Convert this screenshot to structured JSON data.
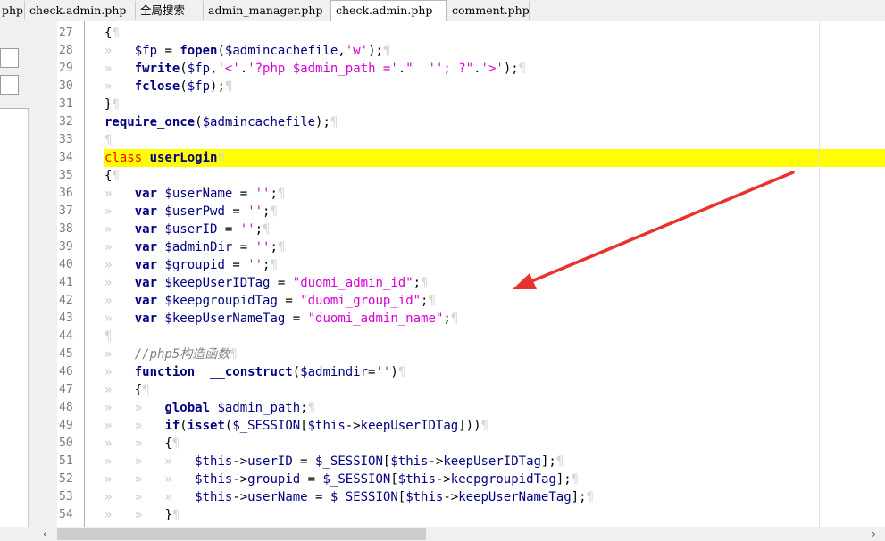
{
  "tabs": [
    {
      "label": "php"
    },
    {
      "label": "check.admin.php"
    },
    {
      "label": "全局搜索"
    },
    {
      "label": "admin_manager.php"
    },
    {
      "label": "check.admin.php"
    },
    {
      "label": "comment.php"
    }
  ],
  "active_tab": 4,
  "scroll": {
    "left": "‹",
    "right": "›"
  },
  "annotation": {
    "color": "#e8322b",
    "kind": "red-arrow"
  },
  "lines": [
    {
      "n": "27",
      "tokens": [
        [
          "",
          "{"
        ],
        [
          "pil",
          "¶"
        ]
      ]
    },
    {
      "n": "28",
      "tokens": [
        [
          "arr",
          "»   "
        ],
        [
          "var",
          "$fp"
        ],
        [
          "",
          ""
        ],
        [
          "",
          " = "
        ],
        [
          "fn",
          "fopen"
        ],
        [
          "",
          "("
        ],
        [
          "var",
          "$admincachefile"
        ],
        [
          "",
          ","
        ],
        [
          "str",
          "'w'"
        ],
        [
          "",
          ");"
        ],
        [
          "pil",
          "¶"
        ]
      ]
    },
    {
      "n": "29",
      "tokens": [
        [
          "arr",
          "»   "
        ],
        [
          "fn",
          "fwrite"
        ],
        [
          "",
          "("
        ],
        [
          "var",
          "$fp"
        ],
        [
          "",
          ","
        ],
        [
          "str",
          "'<'"
        ],
        [
          "",
          "."
        ],
        [
          "str",
          "'?php $admin_path ='"
        ],
        [
          "",
          "."
        ],
        [
          "str",
          "\"  ''; ?\""
        ],
        [
          "",
          "."
        ],
        [
          "str",
          "'>'"
        ],
        [
          "",
          ");"
        ],
        [
          "pil",
          "¶"
        ]
      ]
    },
    {
      "n": "30",
      "tokens": [
        [
          "arr",
          "»   "
        ],
        [
          "fn",
          "fclose"
        ],
        [
          "",
          "("
        ],
        [
          "var",
          "$fp"
        ],
        [
          "",
          ");"
        ],
        [
          "pil",
          "¶"
        ]
      ]
    },
    {
      "n": "31",
      "tokens": [
        [
          "",
          "}"
        ],
        [
          "pil",
          "¶"
        ]
      ]
    },
    {
      "n": "32",
      "tokens": [
        [
          "fn",
          "require_once"
        ],
        [
          "",
          "("
        ],
        [
          "var",
          "$admincachefile"
        ],
        [
          "",
          ");"
        ],
        [
          "pil",
          "¶"
        ]
      ]
    },
    {
      "n": "33",
      "tokens": [
        [
          "pil",
          "¶"
        ]
      ]
    },
    {
      "n": "34",
      "tokens": [
        [
          "red",
          "class"
        ],
        [
          "",
          " "
        ],
        [
          "kw",
          "userLogin"
        ],
        [
          "pil",
          "¶"
        ]
      ]
    },
    {
      "n": "35",
      "tokens": [
        [
          "",
          "{"
        ],
        [
          "pil",
          "¶"
        ]
      ]
    },
    {
      "n": "36",
      "tokens": [
        [
          "arr",
          "»   "
        ],
        [
          "kw",
          "var"
        ],
        [
          "",
          " "
        ],
        [
          "var",
          "$userName"
        ],
        [
          "",
          " = "
        ],
        [
          "str",
          "''"
        ],
        [
          "",
          ";"
        ],
        [
          "pil",
          "¶"
        ]
      ]
    },
    {
      "n": "37",
      "tokens": [
        [
          "arr",
          "»   "
        ],
        [
          "kw",
          "var"
        ],
        [
          "",
          " "
        ],
        [
          "var",
          "$userPwd"
        ],
        [
          "",
          " = "
        ],
        [
          "str",
          "''"
        ],
        [
          "",
          ";"
        ],
        [
          "pil",
          "¶"
        ]
      ]
    },
    {
      "n": "38",
      "tokens": [
        [
          "arr",
          "»   "
        ],
        [
          "kw",
          "var"
        ],
        [
          "",
          " "
        ],
        [
          "var",
          "$userID"
        ],
        [
          "",
          " = "
        ],
        [
          "str",
          "''"
        ],
        [
          "",
          ";"
        ],
        [
          "pil",
          "¶"
        ]
      ]
    },
    {
      "n": "39",
      "tokens": [
        [
          "arr",
          "»   "
        ],
        [
          "kw",
          "var"
        ],
        [
          "",
          " "
        ],
        [
          "var",
          "$adminDir"
        ],
        [
          "",
          " = "
        ],
        [
          "str",
          "''"
        ],
        [
          "",
          ";"
        ],
        [
          "pil",
          "¶"
        ]
      ]
    },
    {
      "n": "40",
      "tokens": [
        [
          "arr",
          "»   "
        ],
        [
          "kw",
          "var"
        ],
        [
          "",
          " "
        ],
        [
          "var",
          "$groupid"
        ],
        [
          "",
          " = "
        ],
        [
          "str",
          "''"
        ],
        [
          "",
          ";"
        ],
        [
          "pil",
          "¶"
        ]
      ]
    },
    {
      "n": "41",
      "tokens": [
        [
          "arr",
          "»   "
        ],
        [
          "kw",
          "var"
        ],
        [
          "",
          " "
        ],
        [
          "var",
          "$keepUserIDTag"
        ],
        [
          "",
          " = "
        ],
        [
          "str",
          "\"duomi_admin_id\""
        ],
        [
          "",
          ";"
        ],
        [
          "pil",
          "¶"
        ]
      ]
    },
    {
      "n": "42",
      "tokens": [
        [
          "arr",
          "»   "
        ],
        [
          "kw",
          "var"
        ],
        [
          "",
          " "
        ],
        [
          "var",
          "$keepgroupidTag"
        ],
        [
          "",
          " = "
        ],
        [
          "str",
          "\"duomi_group_id\""
        ],
        [
          "",
          ";"
        ],
        [
          "pil",
          "¶"
        ]
      ]
    },
    {
      "n": "43",
      "tokens": [
        [
          "arr",
          "»   "
        ],
        [
          "kw",
          "var"
        ],
        [
          "",
          " "
        ],
        [
          "var",
          "$keepUserNameTag"
        ],
        [
          "",
          " = "
        ],
        [
          "str",
          "\"duomi_admin_name\""
        ],
        [
          "",
          ";"
        ],
        [
          "pil",
          "¶"
        ]
      ]
    },
    {
      "n": "44",
      "tokens": [
        [
          "pil",
          "¶"
        ]
      ]
    },
    {
      "n": "45",
      "tokens": [
        [
          "arr",
          "»   "
        ],
        [
          "cm",
          "//php5构造函数"
        ],
        [
          "pil",
          "¶"
        ]
      ]
    },
    {
      "n": "46",
      "tokens": [
        [
          "arr",
          "»   "
        ],
        [
          "kw",
          "function"
        ],
        [
          "",
          "  "
        ],
        [
          "fn",
          "__construct"
        ],
        [
          "",
          "("
        ],
        [
          "var",
          "$admindir"
        ],
        [
          "",
          "="
        ],
        [
          "str",
          "''"
        ],
        [
          "",
          ")"
        ],
        [
          "pil",
          "¶"
        ]
      ]
    },
    {
      "n": "47",
      "tokens": [
        [
          "arr",
          "»   "
        ],
        [
          "",
          "{"
        ],
        [
          "pil",
          "¶"
        ]
      ]
    },
    {
      "n": "48",
      "tokens": [
        [
          "arr",
          "»   »   "
        ],
        [
          "kw",
          "global"
        ],
        [
          "",
          " "
        ],
        [
          "var",
          "$admin_path"
        ],
        [
          "",
          ";"
        ],
        [
          "pil",
          "¶"
        ]
      ]
    },
    {
      "n": "49",
      "tokens": [
        [
          "arr",
          "»   »   "
        ],
        [
          "kw",
          "if"
        ],
        [
          "",
          "("
        ],
        [
          "fn",
          "isset"
        ],
        [
          "",
          "("
        ],
        [
          "var",
          "$_SESSION"
        ],
        [
          "",
          "["
        ],
        [
          "var",
          "$this"
        ],
        [
          "",
          "->"
        ],
        [
          "var",
          "keepUserIDTag"
        ],
        [
          "",
          "]))"
        ],
        [
          "pil",
          "¶"
        ]
      ]
    },
    {
      "n": "50",
      "tokens": [
        [
          "arr",
          "»   »   "
        ],
        [
          "",
          "{"
        ],
        [
          "pil",
          "¶"
        ]
      ]
    },
    {
      "n": "51",
      "tokens": [
        [
          "arr",
          "»   »   »   "
        ],
        [
          "var",
          "$this"
        ],
        [
          "",
          "->"
        ],
        [
          "var",
          "userID"
        ],
        [
          "",
          " = "
        ],
        [
          "var",
          "$_SESSION"
        ],
        [
          "",
          "["
        ],
        [
          "var",
          "$this"
        ],
        [
          "",
          "->"
        ],
        [
          "var",
          "keepUserIDTag"
        ],
        [
          "",
          "];"
        ],
        [
          "pil",
          "¶"
        ]
      ]
    },
    {
      "n": "52",
      "tokens": [
        [
          "arr",
          "»   »   »   "
        ],
        [
          "var",
          "$this"
        ],
        [
          "",
          "->"
        ],
        [
          "var",
          "groupid"
        ],
        [
          "",
          " = "
        ],
        [
          "var",
          "$_SESSION"
        ],
        [
          "",
          "["
        ],
        [
          "var",
          "$this"
        ],
        [
          "",
          "->"
        ],
        [
          "var",
          "keepgroupidTag"
        ],
        [
          "",
          "];"
        ],
        [
          "pil",
          "¶"
        ]
      ]
    },
    {
      "n": "53",
      "tokens": [
        [
          "arr",
          "»   »   »   "
        ],
        [
          "var",
          "$this"
        ],
        [
          "",
          "->"
        ],
        [
          "var",
          "userName"
        ],
        [
          "",
          " = "
        ],
        [
          "var",
          "$_SESSION"
        ],
        [
          "",
          "["
        ],
        [
          "var",
          "$this"
        ],
        [
          "",
          "->"
        ],
        [
          "var",
          "keepUserNameTag"
        ],
        [
          "",
          "];"
        ],
        [
          "pil",
          "¶"
        ]
      ]
    },
    {
      "n": "54",
      "tokens": [
        [
          "arr",
          "»   »   "
        ],
        [
          "",
          "}"
        ],
        [
          "pil",
          "¶"
        ]
      ]
    }
  ]
}
